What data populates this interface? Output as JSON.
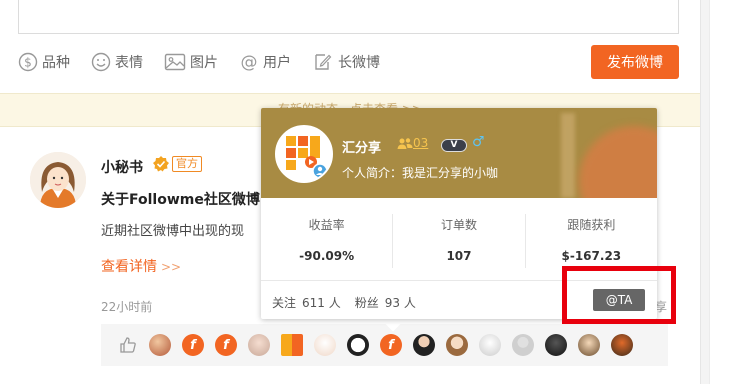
{
  "toolbar": {
    "tools": [
      {
        "label": "品种",
        "icon": "dollar-circle-icon"
      },
      {
        "label": "表情",
        "icon": "smiley-icon"
      },
      {
        "label": "图片",
        "icon": "image-icon"
      },
      {
        "label": "用户",
        "icon": "at-icon"
      },
      {
        "label": "长微博",
        "icon": "edit-icon"
      }
    ],
    "publish_label": "发布微博"
  },
  "notice": {
    "text": "有新的动态，点击查看 >>"
  },
  "post": {
    "author": "小秘书",
    "verify_badge": "官方",
    "title": "关于Followme社区微博",
    "body": "近期社区微博中出现的现",
    "more_label": "查看详情",
    "more_arrow": ">>",
    "time": "22小时前",
    "share_cut": "享"
  },
  "likes": {
    "icon": "thumb-up-icon",
    "avatars": [
      "photo",
      "f",
      "f",
      "photo",
      "huifenxiang",
      "photo",
      "panda",
      "f",
      "photo",
      "photo",
      "photo",
      "default",
      "photo",
      "photo",
      "photo"
    ]
  },
  "popup": {
    "name": "汇分享",
    "fans_count": "03",
    "vip_badge": "V",
    "gender_symbol": "♂",
    "bio": "个人简介：我是汇分享的小咖",
    "stats": [
      {
        "label": "收益率",
        "value": "-90.09%"
      },
      {
        "label": "订单数",
        "value": "107"
      },
      {
        "label": "跟随获利",
        "value": "$-167.23"
      }
    ],
    "following_label": "关注",
    "following_count": "611 人",
    "followers_label": "粉丝",
    "followers_count": "93 人",
    "at_button": "@TA"
  },
  "colors": {
    "accent": "#f26522",
    "popup_header": "#a88b43",
    "highlight": "#e8000d",
    "notice_bg": "#fcf7e4"
  }
}
